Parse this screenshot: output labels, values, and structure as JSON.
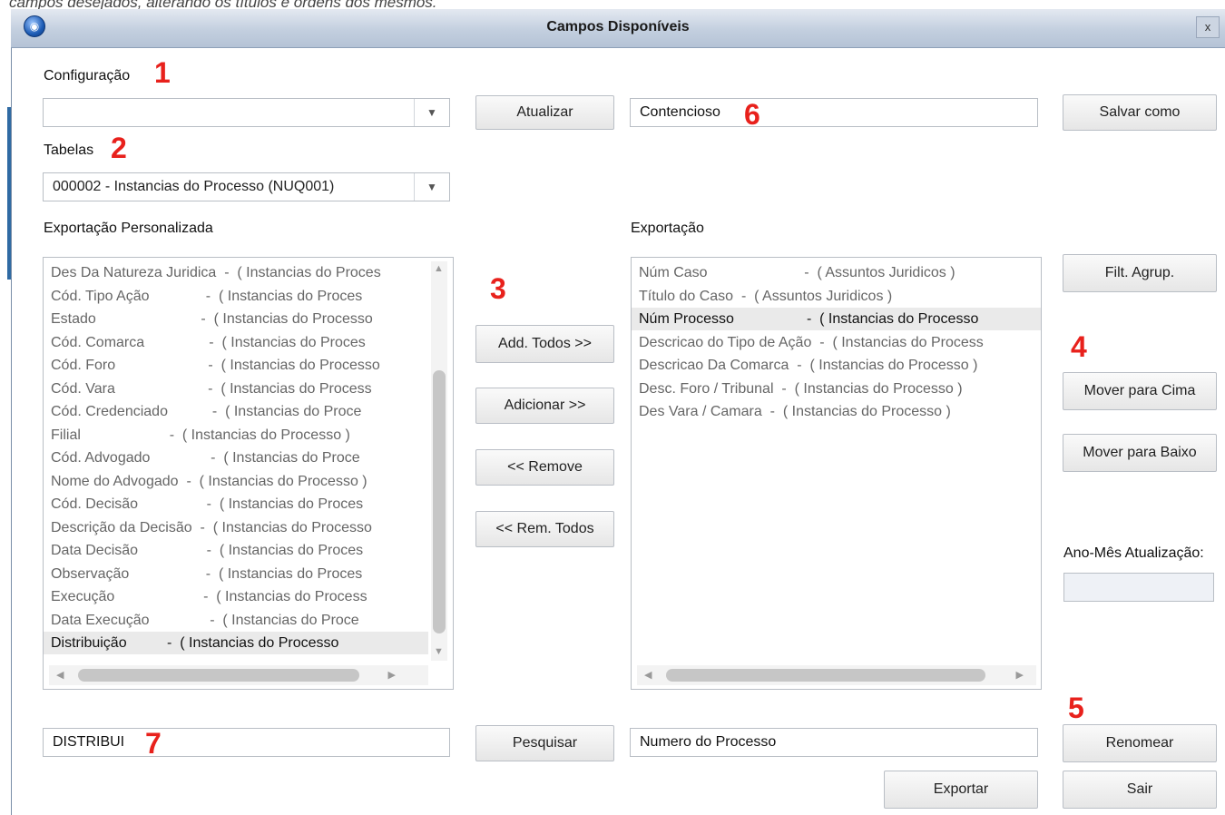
{
  "doc_text": "campos desejados, alterando os títulos e ordens dos mesmos.",
  "window": {
    "title": "Campos Disponíveis",
    "close": "x"
  },
  "markers": {
    "m1": "1",
    "m2": "2",
    "m3": "3",
    "m4": "4",
    "m5": "5",
    "m6": "6",
    "m7": "7"
  },
  "configuracao": {
    "label": "Configuração",
    "value": ""
  },
  "tabelas": {
    "label": "Tabelas",
    "value": "000002 - Instancias do Processo (NUQ001)"
  },
  "buttons": {
    "atualizar": "Atualizar",
    "salvar_como": "Salvar como",
    "filt_agrup": "Filt. Agrup.",
    "add_todos": "Add. Todos >>",
    "adicionar": "Adicionar >>",
    "remove": "<< Remove",
    "rem_todos": "<< Rem. Todos",
    "mover_cima": "Mover para Cima",
    "mover_baixo": "Mover para Baixo",
    "pesquisar": "Pesquisar",
    "renomear": "Renomear",
    "exportar": "Exportar",
    "sair": "Sair"
  },
  "export_name": "Contencioso",
  "left_list": {
    "label": "Exportação Personalizada",
    "items": [
      "Des Da Natureza Juridica  -  ( Instancias do Proces",
      "Cód. Tipo Ação              -  ( Instancias do Proces",
      "Estado                          -  ( Instancias do Processo",
      "Cód. Comarca                -  ( Instancias do Proces",
      "Cód. Foro                       -  ( Instancias do Processo",
      "Cód. Vara                       -  ( Instancias do Process",
      "Cód. Credenciado           -  ( Instancias do Proce",
      "Filial                      -  ( Instancias do Processo )",
      "Cód. Advogado               -  ( Instancias do Proce",
      "Nome do Advogado  -  ( Instancias do Processo )",
      "Cód. Decisão                 -  ( Instancias do Proces",
      "Descrição da Decisão  -  ( Instancias do Processo",
      "Data Decisão                 -  ( Instancias do Proces",
      "Observação                   -  ( Instancias do Proces",
      "Execução                      -  ( Instancias do Process",
      "Data Execução               -  ( Instancias do Proce",
      "Distribuição          -  ( Instancias do Processo"
    ],
    "selected_index": 16
  },
  "right_list": {
    "label": "Exportação",
    "items": [
      "Núm Caso                        -  ( Assuntos Juridicos )",
      "Título do Caso  -  ( Assuntos Juridicos )",
      "Núm Processo                  -  ( Instancias do Processo",
      "Descricao do Tipo de Ação  -  ( Instancias do Process",
      "Descricao Da Comarca  -  ( Instancias do Processo )",
      "Desc. Foro / Tribunal  -  ( Instancias do Processo )",
      "Des Vara / Camara  -  ( Instancias do Processo )"
    ],
    "selected_index": 2
  },
  "ano_mes": {
    "label": "Ano-Mês Atualização:",
    "value": ""
  },
  "search": {
    "value": "DISTRIBUI"
  },
  "rename": {
    "value": "Numero do Processo"
  }
}
